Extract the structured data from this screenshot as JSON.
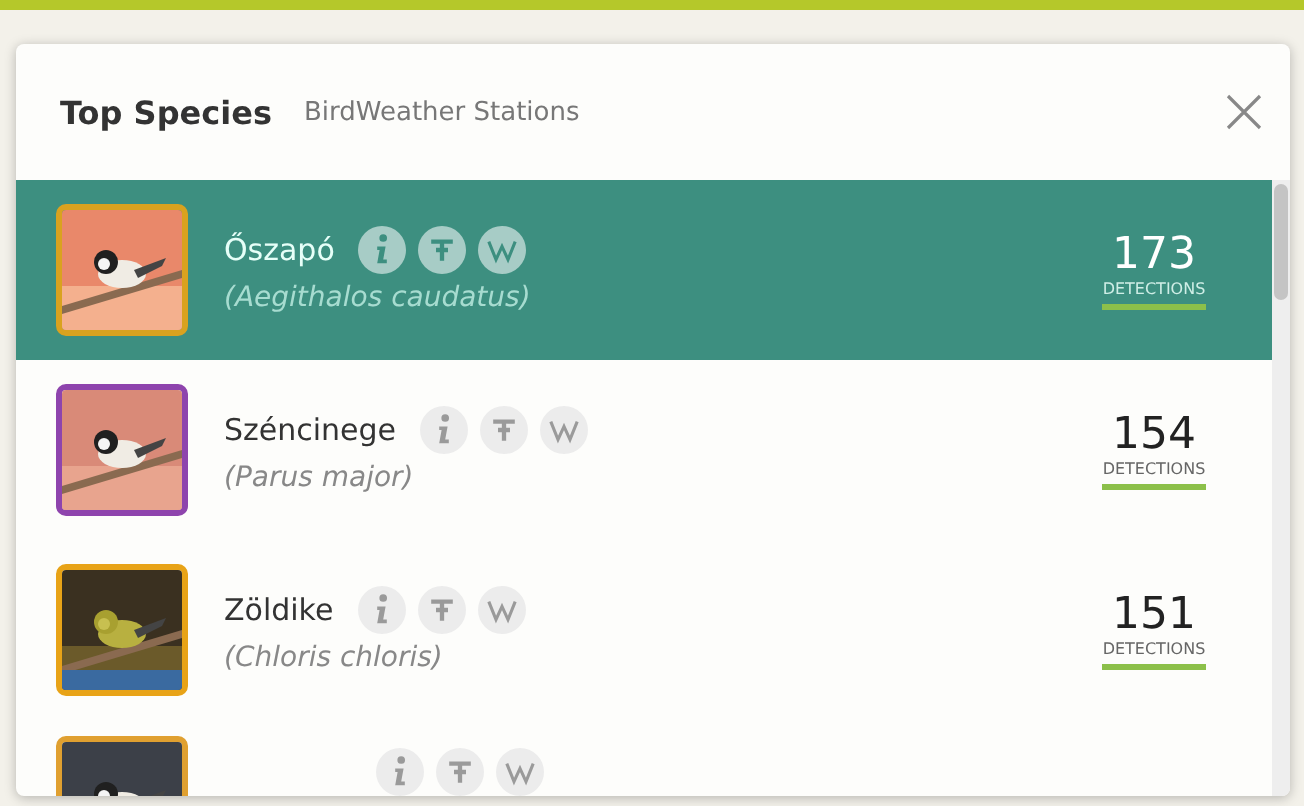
{
  "panel": {
    "title": "Top Species",
    "subtitle": "BirdWeather Stations"
  },
  "species": [
    {
      "name": "Őszapó",
      "scientific": "(Aegithalos caudatus)",
      "count": "173",
      "count_label": "DETECTIONS",
      "selected": true,
      "color": "#d9a21f"
    },
    {
      "name": "Széncinege",
      "scientific": "(Parus major)",
      "count": "154",
      "count_label": "DETECTIONS",
      "selected": false,
      "color": "#8e44ad"
    },
    {
      "name": "Zöldike",
      "scientific": "(Chloris chloris)",
      "count": "151",
      "count_label": "DETECTIONS",
      "selected": false,
      "color": "#e8a317"
    }
  ],
  "partial_row": {
    "color": "#e0a030"
  }
}
